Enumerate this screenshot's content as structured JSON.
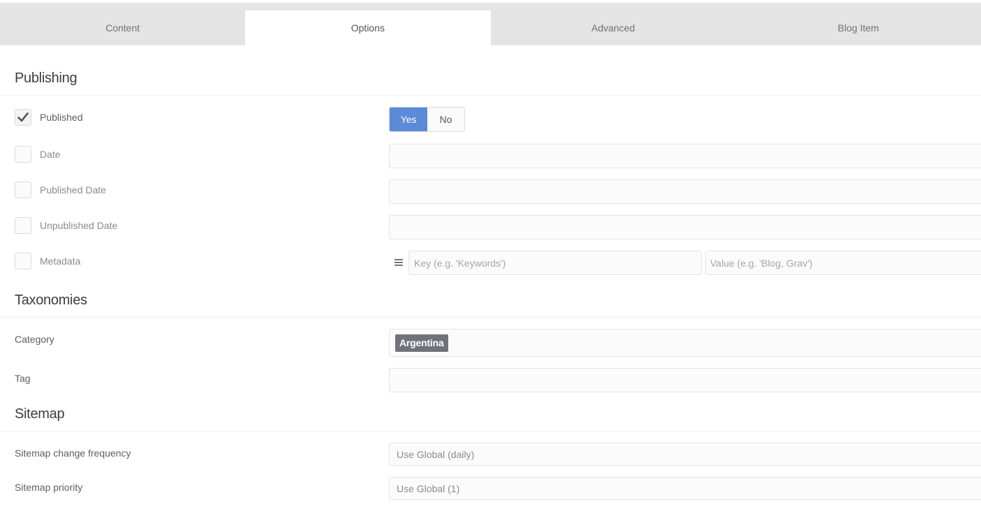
{
  "tabs": [
    {
      "label": "Content",
      "active": false
    },
    {
      "label": "Options",
      "active": true
    },
    {
      "label": "Advanced",
      "active": false
    },
    {
      "label": "Blog Item",
      "active": false
    }
  ],
  "publishing": {
    "title": "Publishing",
    "published": {
      "label": "Published",
      "checked": true,
      "yes": "Yes",
      "no": "No",
      "value": "Yes"
    },
    "date": {
      "label": "Date",
      "checked": false,
      "value": ""
    },
    "published_date": {
      "label": "Published Date",
      "checked": false,
      "value": ""
    },
    "unpublished_date": {
      "label": "Unpublished Date",
      "checked": false,
      "value": ""
    },
    "metadata": {
      "label": "Metadata",
      "checked": false,
      "key_placeholder": "Key (e.g. 'Keywords')",
      "value_placeholder": "Value (e.g. 'Blog, Grav')"
    }
  },
  "taxonomies": {
    "title": "Taxonomies",
    "category": {
      "label": "Category",
      "tags": [
        "Argentina"
      ]
    },
    "tag": {
      "label": "Tag",
      "tags": []
    }
  },
  "sitemap": {
    "title": "Sitemap",
    "changefreq": {
      "label": "Sitemap change frequency",
      "value": "Use Global (daily)"
    },
    "priority": {
      "label": "Sitemap priority",
      "value": "Use Global (1)"
    }
  },
  "colors": {
    "accent": "#5a8ad8",
    "chip": "#6f7379",
    "tab_bg": "#e4e4e4"
  }
}
